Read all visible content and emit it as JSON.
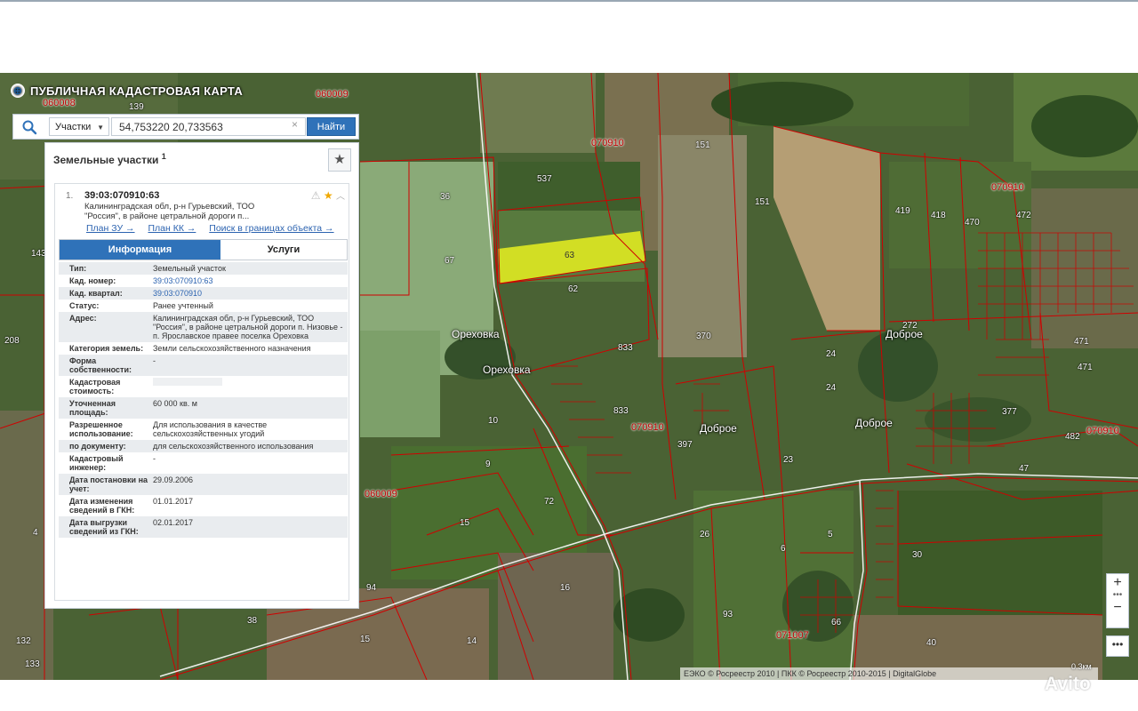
{
  "header": {
    "app_title": "ПУБЛИЧНАЯ КАДАСТРОВАЯ КАРТА"
  },
  "search": {
    "type_label": "Участки",
    "query": "54,753220 20,733563",
    "find_label": "Найти"
  },
  "panel": {
    "title": "Земельные участки",
    "count": "1",
    "result": {
      "index": "1.",
      "cad_number": "39:03:070910:63",
      "address_short": "Калининградская обл, р-н Гурьевский, ТОО \"Россия\", в районе цетральной дороги п...",
      "links": [
        "План ЗУ →",
        "План КК →",
        "Поиск в границах объекта →"
      ],
      "tabs": [
        "Информация",
        "Услуги"
      ],
      "attributes": [
        {
          "label": "Тип:",
          "value": "Земельный участок"
        },
        {
          "label": "Кад. номер:",
          "value": "39:03:070910:63"
        },
        {
          "label": "Кад. квартал:",
          "value": "39:03:070910"
        },
        {
          "label": "Статус:",
          "value": "Ранее учтенный"
        },
        {
          "label": "Адрес:",
          "value": "Калининградская обл, р-н Гурьевский, ТОО \"Россия\", в районе цетральной дороги п. Низовье - п. Ярославское правее поселка Ореховка"
        },
        {
          "label": "Категория земель:",
          "value": "Земли сельскохозяйственного назначения"
        },
        {
          "label": "Форма собственности:",
          "value": "-"
        },
        {
          "label": "Кадастровая стоимость:",
          "value": ""
        },
        {
          "label": "Уточненная площадь:",
          "value": "60 000 кв. м"
        },
        {
          "label": "Разрешенное использование:",
          "value": "Для использования в качестве сельскохозяйственных угодий"
        },
        {
          "label": "по документу:",
          "value": "для сельскохозяйственного использования"
        },
        {
          "label": "Кадастровый инженер:",
          "value": "-"
        },
        {
          "label": "Дата постановки на учет:",
          "value": "29.09.2006"
        },
        {
          "label": "Дата изменения сведений в ГКН:",
          "value": "01.01.2017"
        },
        {
          "label": "Дата выгрузки сведений из ГКН:",
          "value": "02.01.2017"
        }
      ]
    }
  },
  "map": {
    "quarters": [
      "060009",
      "060008",
      "070910",
      "070910",
      "070910",
      "060009",
      "071007",
      "070910"
    ],
    "places": [
      "Ореховка",
      "Ореховка",
      "Доброе",
      "Доброе",
      "Доброе"
    ],
    "parcels": [
      "139",
      "537",
      "151",
      "151",
      "36",
      "67",
      "63",
      "62",
      "419",
      "418",
      "470",
      "472",
      "143",
      "208",
      "370",
      "833",
      "833",
      "24",
      "24",
      "272",
      "471",
      "471",
      "377",
      "482",
      "10",
      "397",
      "23",
      "47",
      "9",
      "72",
      "15",
      "26",
      "6",
      "5",
      "30",
      "16",
      "94",
      "14",
      "93",
      "15",
      "38",
      "66",
      "40",
      "132",
      "133",
      "4"
    ],
    "attribution": "ЕЭКО © Росреестр 2010 | ПКК © Росреестр 2010-2015 | DigitalGlobe",
    "scale": "0.3км",
    "watermark": "Avito"
  },
  "colors": {
    "accent": "#2f72b9",
    "parcel_border": "#c00000",
    "selected_parcel": "#e8f020"
  }
}
